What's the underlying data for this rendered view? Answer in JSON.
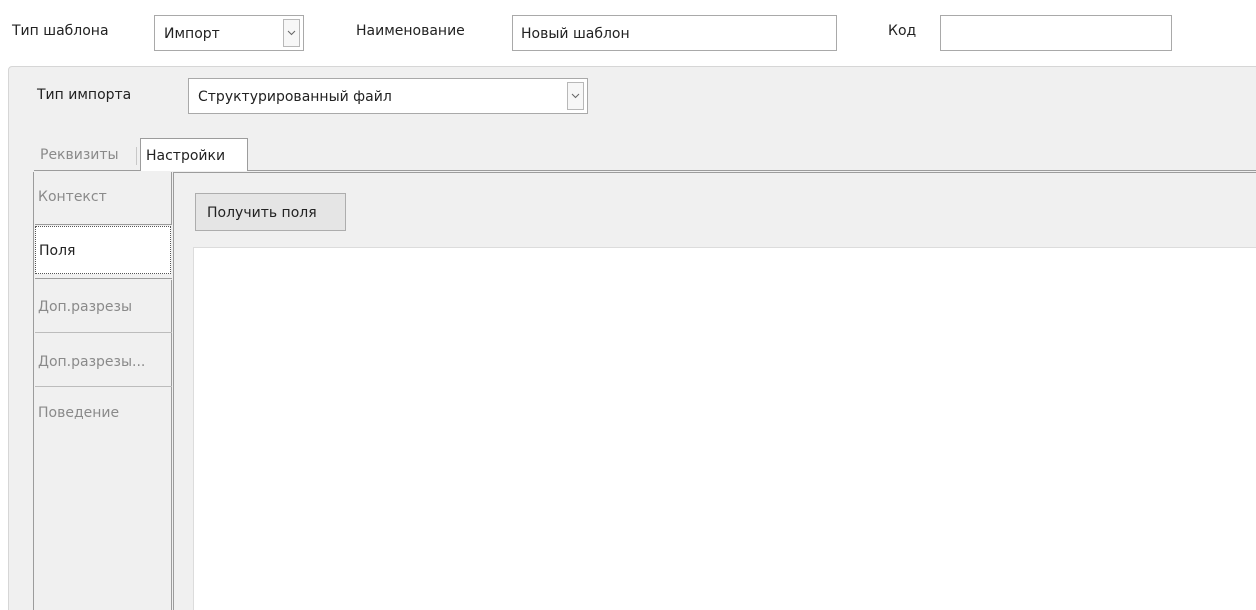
{
  "header": {
    "template_type_label": "Тип шаблона",
    "template_type_value": "Импорт",
    "name_label": "Наименование",
    "name_value": "Новый шаблон",
    "code_label": "Код",
    "code_value": ""
  },
  "import": {
    "type_label": "Тип импорта",
    "type_value": "Структурированный файл"
  },
  "tabs": [
    {
      "label": "Реквизиты",
      "active": false
    },
    {
      "label": "Настройки",
      "active": true
    }
  ],
  "vertical_tabs": [
    {
      "label": "Контекст",
      "active": false
    },
    {
      "label": "Поля",
      "active": true
    },
    {
      "label": "Доп.разрезы",
      "active": false
    },
    {
      "label": "Доп.разрезы...",
      "active": false
    },
    {
      "label": "Поведение",
      "active": false
    }
  ],
  "fields_panel": {
    "get_fields_label": "Получить поля"
  },
  "icons": {
    "dropdown": "chevron-down-icon"
  }
}
